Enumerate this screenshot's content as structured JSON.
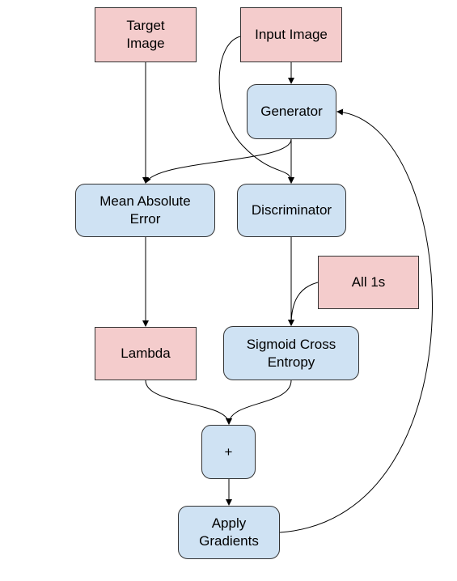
{
  "colors": {
    "input_node": "#f4cccc",
    "process_node": "#cfe2f3",
    "stroke": "#333333"
  },
  "nodes": {
    "target_image": "Target\nImage",
    "input_image": "Input Image",
    "generator": "Generator",
    "mean_absolute_error": "Mean Absolute\nError",
    "discriminator": "Discriminator",
    "all_ones": "All 1s",
    "lambda": "Lambda",
    "sigmoid_cross_entropy": "Sigmoid Cross\nEntropy",
    "plus": "+",
    "apply_gradients": "Apply\nGradients"
  }
}
